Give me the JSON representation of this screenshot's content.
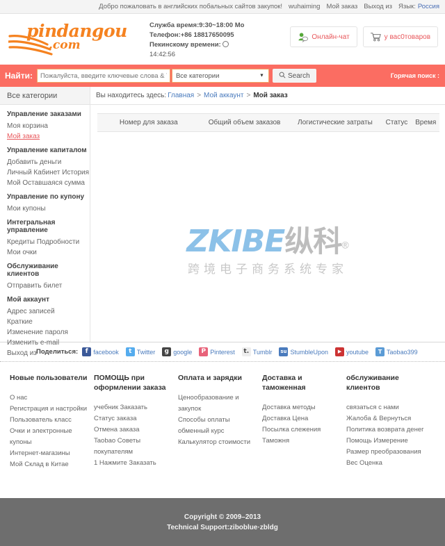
{
  "topbar": {
    "welcome": "Добро пожаловать в английских побальных сайтов закупок!",
    "user": "wuhaiming",
    "my_order": "Мой заказ",
    "logout": "Выход из",
    "lang_label": "Язык:",
    "lang_value": "Россия"
  },
  "header": {
    "logo_brand": "pindangou",
    "logo_dotcom": ".com",
    "service_time": "Служба время:9:30~18:00 Mo",
    "phone": "Телефон:+86 18817650095",
    "beijing_time_label": "Пекинскому времени:",
    "beijing_time_value": "14:42:56",
    "chat_button": "Онлайн-чат",
    "cart_button": "у вас0товаров"
  },
  "search": {
    "label": "Найти:",
    "placeholder": "Пожалуйста, введите ключевые слова & Taob",
    "category_selected": "Все категории",
    "button": "Search",
    "hot_search": "Горячая поиск :"
  },
  "sidebar": {
    "heading": "Все категории",
    "groups": [
      {
        "title": "Управление заказами",
        "items": [
          {
            "label": "Моя корзина",
            "active": false
          },
          {
            "label": "Мой заказ",
            "active": true
          }
        ]
      },
      {
        "title": "Управление капиталом",
        "items": [
          {
            "label": "Добавить деньги",
            "active": false
          },
          {
            "label": "Личный Кабинет История",
            "active": false
          },
          {
            "label": "Мой Оставшаяся сумма",
            "active": false
          }
        ]
      },
      {
        "title": "Управление по купону",
        "items": [
          {
            "label": "Мои купоны",
            "active": false
          }
        ]
      },
      {
        "title": "Интегральная управление",
        "items": [
          {
            "label": "Кредиты Подробности",
            "active": false
          },
          {
            "label": "Мои очки",
            "active": false
          }
        ]
      },
      {
        "title": "Обслуживание клиентов",
        "items": [
          {
            "label": "Отправить билет",
            "active": false
          }
        ]
      },
      {
        "title": "Мой аккаунт",
        "items": [
          {
            "label": "Адрес записей",
            "active": false
          },
          {
            "label": "Краткие",
            "active": false
          },
          {
            "label": "Изменение пароля",
            "active": false
          },
          {
            "label": "Изменить e-mail",
            "active": false
          },
          {
            "label": "Выход из",
            "active": false
          }
        ]
      }
    ]
  },
  "breadcrumb": {
    "prefix": "Вы находитесь здесь:",
    "home": "Главная",
    "account": "Мой аккаунт",
    "current": "Мой заказ",
    "separator": ">"
  },
  "orders_table": {
    "columns": [
      "Номер для заказа",
      "Общий объем заказов",
      "Логистические затраты",
      "Статус",
      "Время"
    ],
    "rows": []
  },
  "watermark": {
    "latin": "ZKIBE",
    "cn": "纵科",
    "registered": "®",
    "subtitle": "跨境电子商务系统专家"
  },
  "share": {
    "label": "Поделиться:",
    "items": [
      {
        "name": "facebook",
        "glyph": "f",
        "color": "#3b5998"
      },
      {
        "name": "Twitter",
        "glyph": "t",
        "color": "#55acee"
      },
      {
        "name": "google",
        "glyph": "g",
        "color": "#444444"
      },
      {
        "name": "Pinterest",
        "glyph": "P",
        "color": "#e8637a"
      },
      {
        "name": "Tumblr",
        "glyph": "t.",
        "color": "#eeeeee"
      },
      {
        "name": "StumbleUpon",
        "glyph": "su",
        "color": "#4a7bbd"
      },
      {
        "name": "youtube",
        "glyph": "▶",
        "color": "#cc3333"
      },
      {
        "name": "Taobao399",
        "glyph": "T",
        "color": "#5b9bd5"
      }
    ]
  },
  "footer": {
    "columns": [
      {
        "title": "Новые пользователи",
        "links": [
          "О нас",
          "Регистрация и настройки",
          "Пользователь класс",
          "Очки и электронные купоны",
          "Интернет-магазины",
          "Мой Склад в Китае"
        ]
      },
      {
        "title": "ПОМОЩЬ при оформлении заказа",
        "links": [
          "учебник Заказать",
          "Статус заказа",
          "Отмена заказа",
          "Taobao Советы покупателям",
          "1 Нажмите Заказать"
        ]
      },
      {
        "title": "Оплата и зарядки",
        "links": [
          "Ценообразование и закупок",
          "Способы оплаты",
          "обменный курс",
          "Калькулятор стоимости"
        ]
      },
      {
        "title": "Доставка и таможенная",
        "links": [
          "Доставка методы",
          "Доставка Цена",
          "Посылка слежения",
          "Таможня"
        ]
      },
      {
        "title": "обслуживание клиентов",
        "links": [
          "связаться с нами",
          "Жалоба & Вернуться",
          "Политика возврата денег",
          "Помощь Измерение",
          "Размер преобразования",
          "Вес Оценка"
        ]
      }
    ]
  },
  "copyright": {
    "line1": "Copyright © 2009–2013",
    "line2": "Technical Support:ziboblue·zbldg"
  },
  "colors": {
    "accent_red": "#fb6d62",
    "brand_orange": "#f58220",
    "link_blue": "#4a7bbd",
    "footer_gray": "#6e6e6e"
  }
}
